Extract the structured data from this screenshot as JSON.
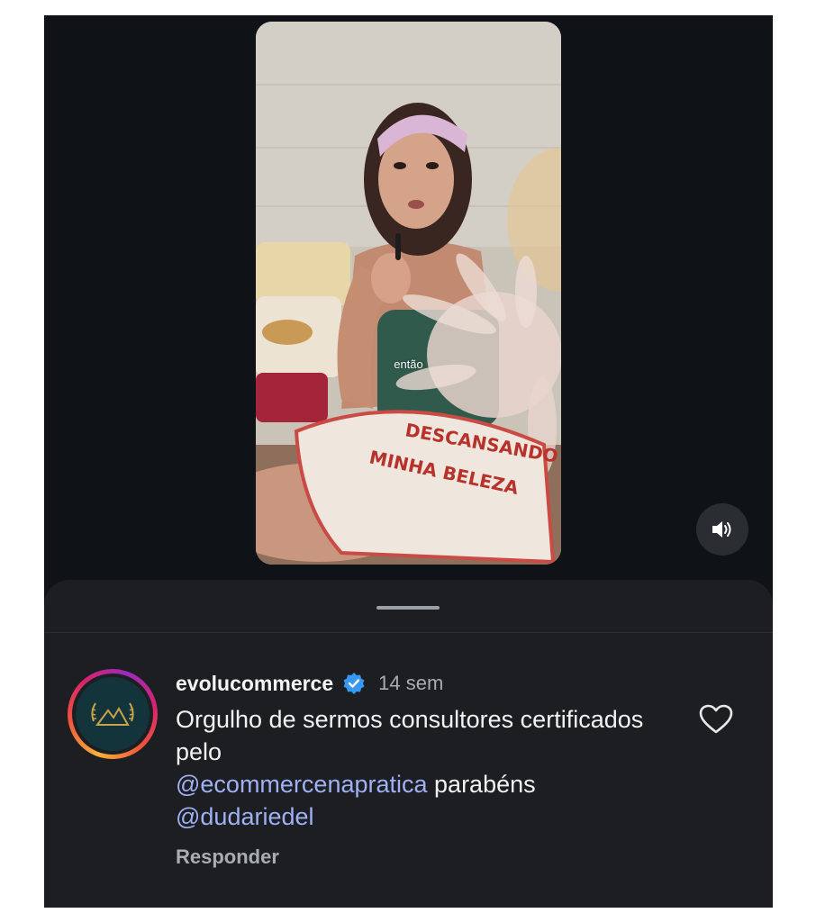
{
  "video": {
    "caption_overlay": "então",
    "pillow_text_line1": "DESCANSANDO",
    "pillow_text_line2": "MINHA BELEZA"
  },
  "comment": {
    "username": "evolucommerce",
    "verified": true,
    "time": "14 sem",
    "text_part1": "Orgulho de sermos consultores certificados pelo",
    "mention1": "@ecommercenapratica",
    "text_part2": " parabéns",
    "mention2": "@dudariedel",
    "reply_label": "Responder"
  },
  "icons": {
    "sound": "speaker-icon",
    "like": "heart-icon",
    "verified": "verified-badge-icon"
  },
  "colors": {
    "background": "#0f1216",
    "sheet": "#1c1e22",
    "mention": "#9fb0f5",
    "verified": "#3897f0"
  }
}
